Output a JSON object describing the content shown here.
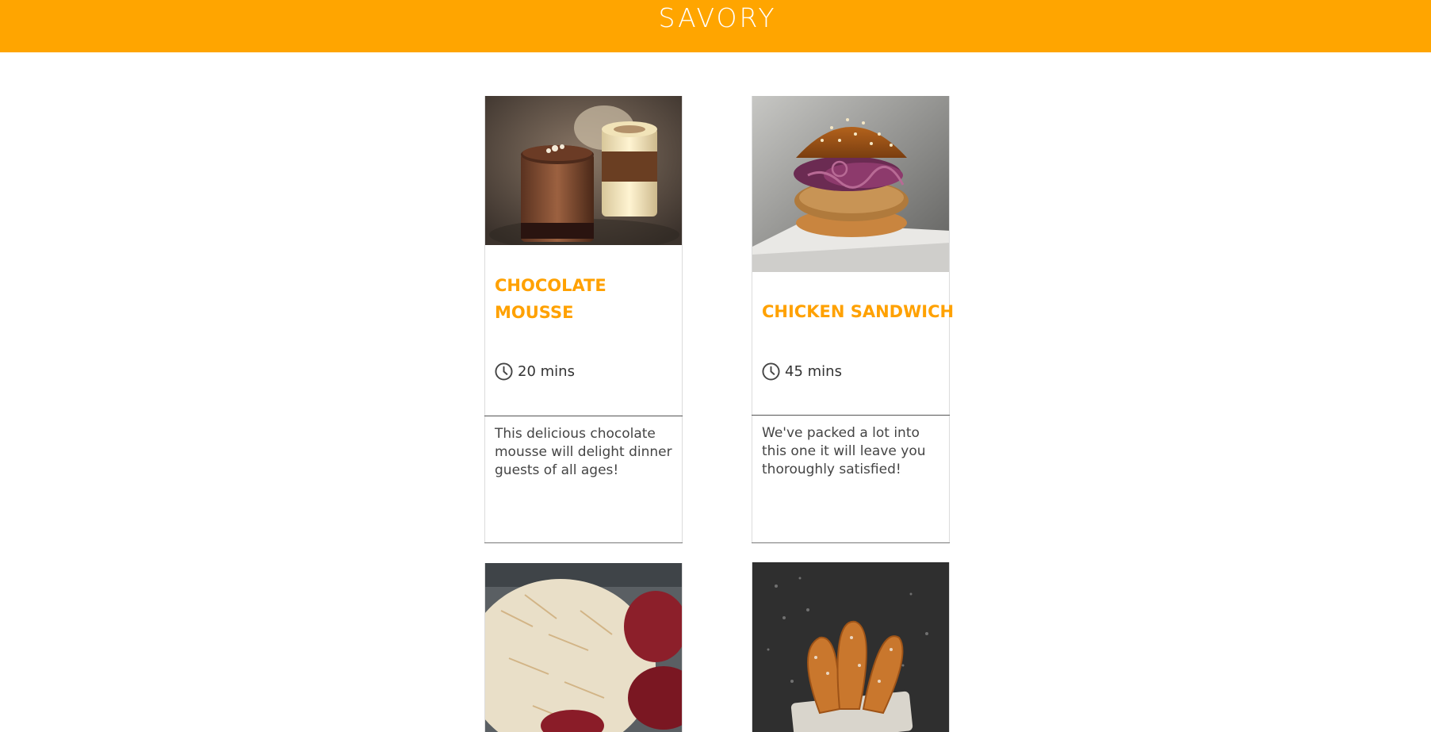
{
  "header": {
    "title": "SAVORY",
    "background_color": "#ffa500"
  },
  "recipes": [
    {
      "title": "CHOCOLATE MOUSSE",
      "time": "20 mins",
      "description": "This delicious chocolate mousse will delight dinner guests of all ages!",
      "image": "chocolate-mousse-dessert-photo"
    },
    {
      "title": "CHICKEN SANDWICH",
      "time": "45 mins",
      "description": "We've packed a lot into this one it will leave you thoroughly satisfied!",
      "image": "chicken-burger-photo"
    },
    {
      "image": "rice-dish-photo"
    },
    {
      "image": "churros-photo"
    }
  ],
  "icons": {
    "time": "clock-icon"
  },
  "colors": {
    "accent": "#ffa100",
    "text": "#444444"
  }
}
